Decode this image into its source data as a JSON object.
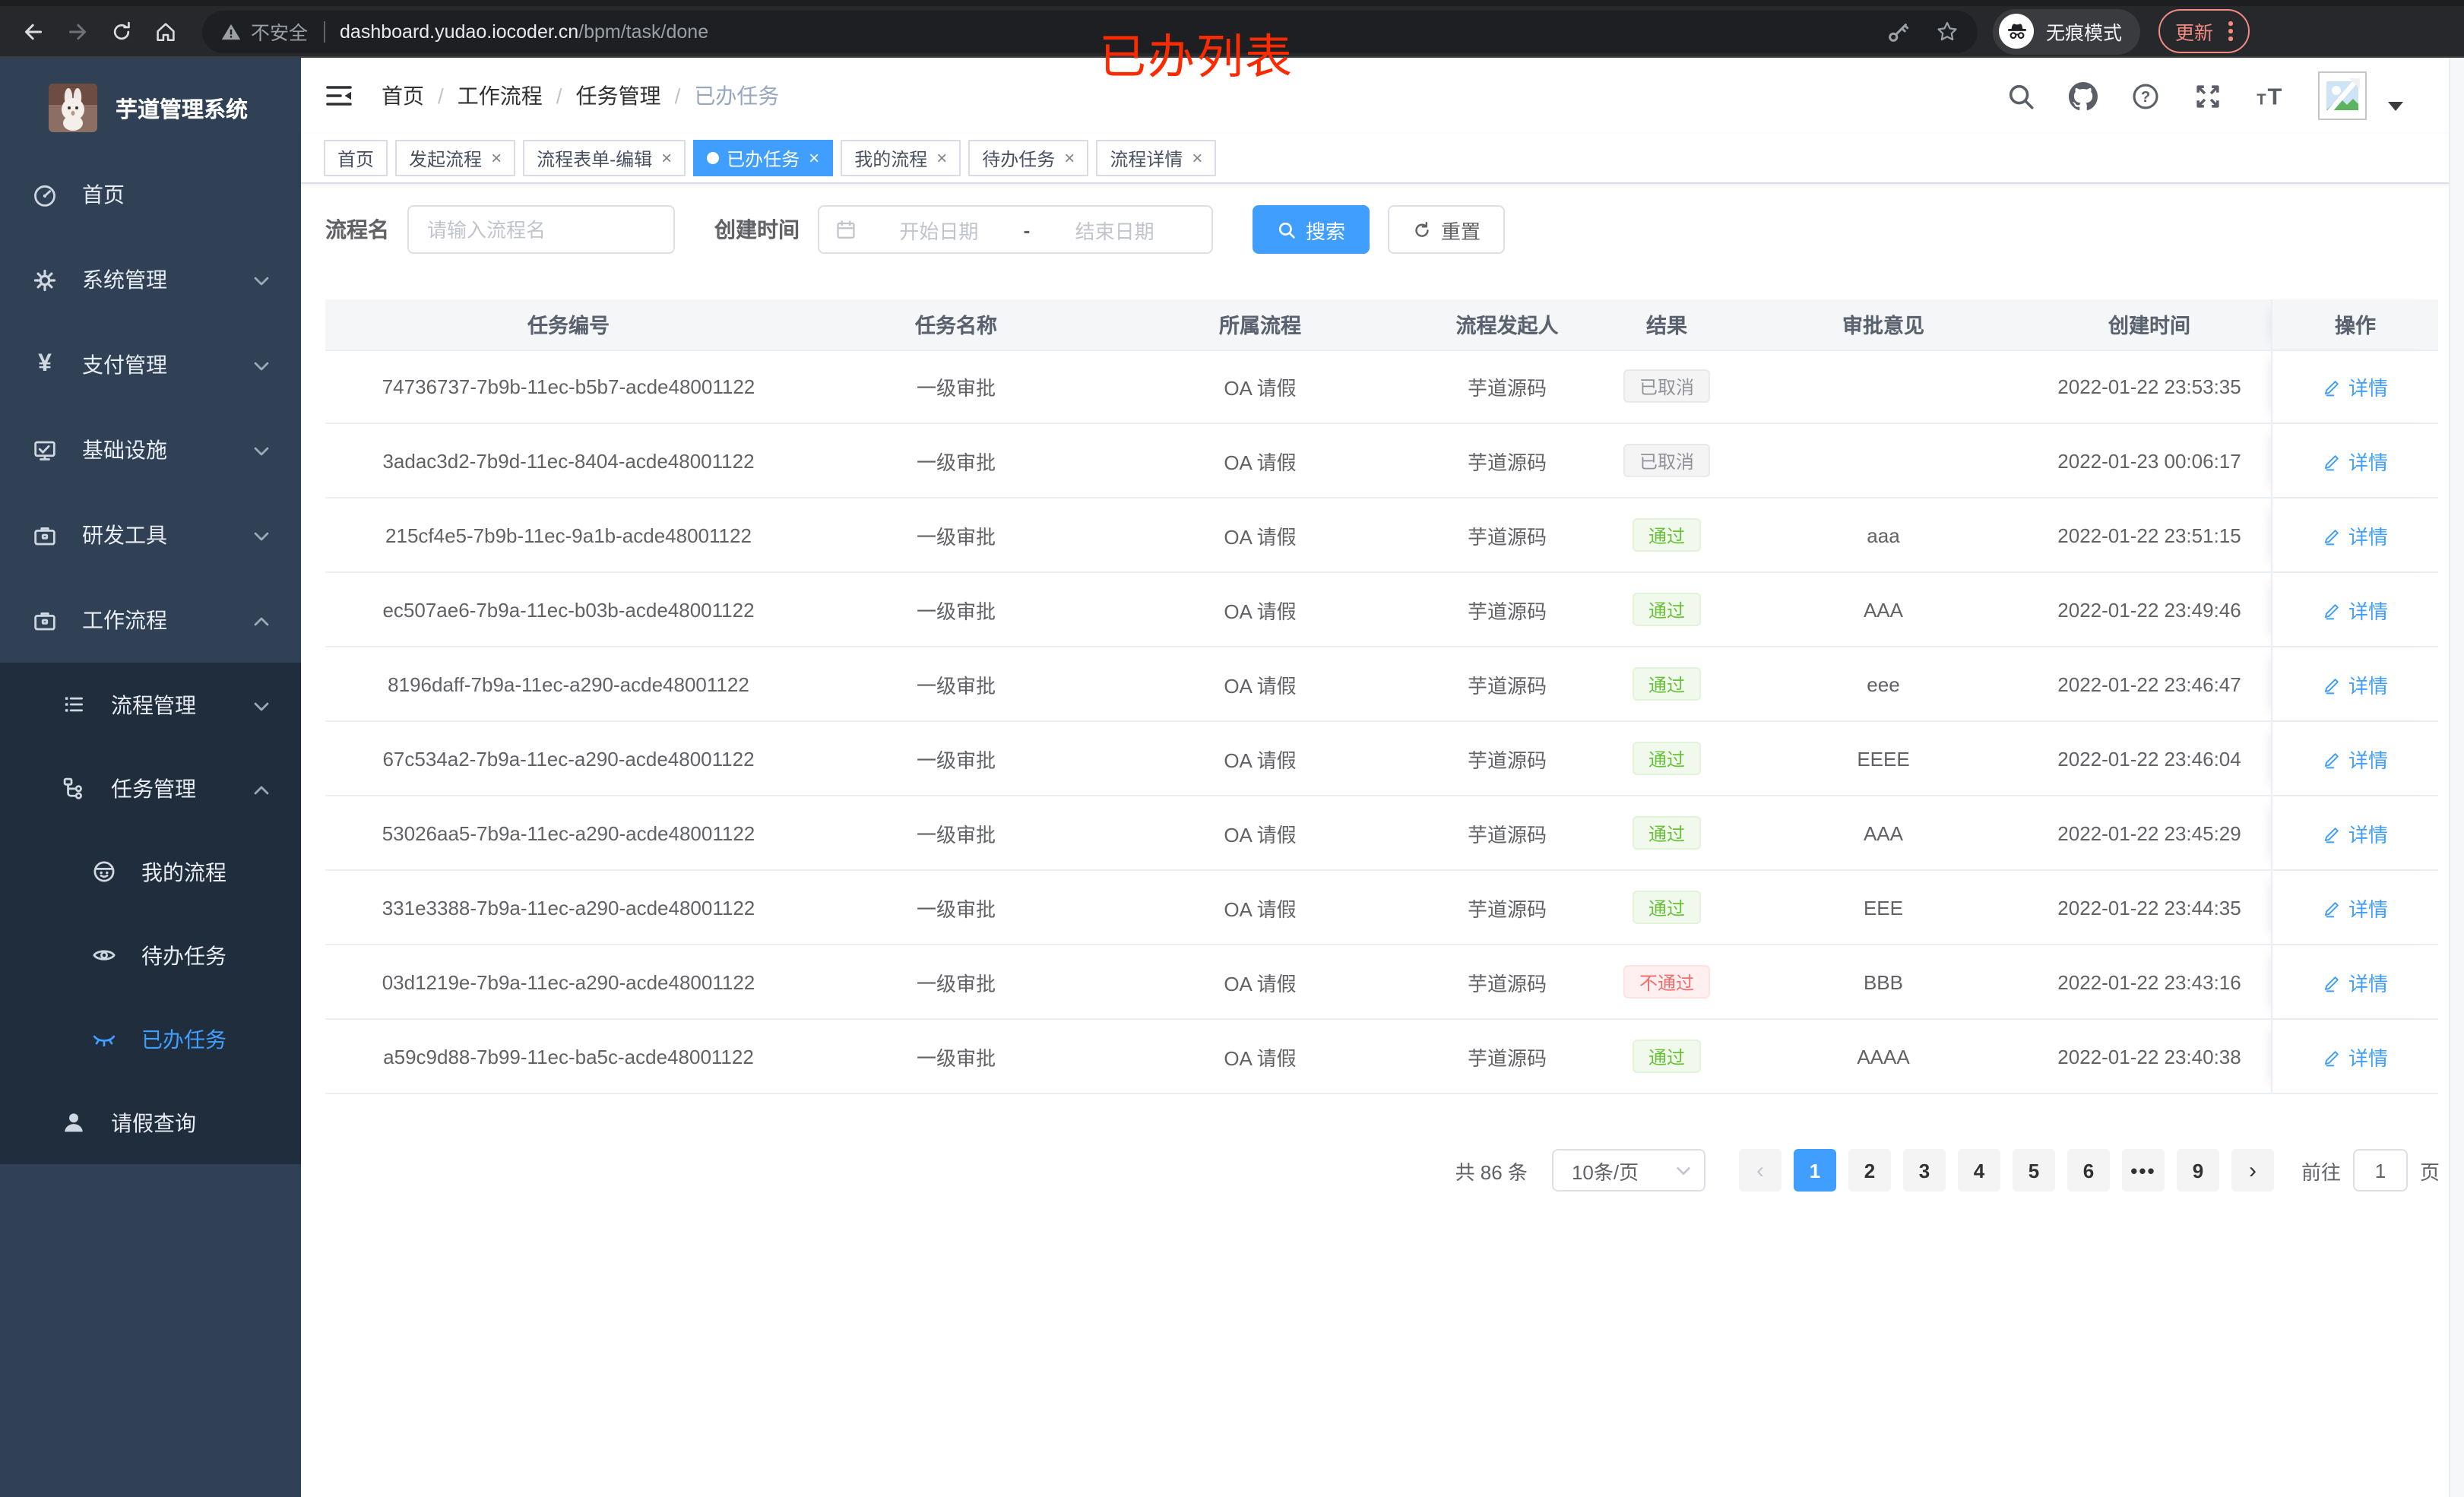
{
  "colors": {
    "primary": "#409eff",
    "success_text": "#67c23a",
    "danger_text": "#f56c6c",
    "info_text": "#909399",
    "overlay_red": "#fa2b00",
    "sidebar_bg": "#304156",
    "submenu_bg": "#1f2d3d"
  },
  "browser": {
    "security_label": "不安全",
    "url_host": "dashboard.yudao.iocoder.cn",
    "url_path": "/bpm/task/done",
    "incognito_label": "无痕模式",
    "update_label": "更新",
    "overlay_title": "已办列表"
  },
  "sidebar": {
    "app_title": "芋道管理系统",
    "items": [
      {
        "label": "首页",
        "icon": "dashboard-icon",
        "level": 1
      },
      {
        "label": "系统管理",
        "icon": "gear-icon",
        "level": 1,
        "chevron": "down"
      },
      {
        "label": "支付管理",
        "icon": "yen-icon",
        "level": 1,
        "chevron": "down"
      },
      {
        "label": "基础设施",
        "icon": "infra-icon",
        "level": 1,
        "chevron": "down"
      },
      {
        "label": "研发工具",
        "icon": "toolbox-icon",
        "level": 1,
        "chevron": "down"
      },
      {
        "label": "工作流程",
        "icon": "workflow-icon",
        "level": 1,
        "chevron": "up"
      },
      {
        "label": "流程管理",
        "icon": "process-list-icon",
        "level": 2,
        "chevron": "down",
        "dark": true
      },
      {
        "label": "任务管理",
        "icon": "task-tree-icon",
        "level": 2,
        "chevron": "up",
        "dark": true
      },
      {
        "label": "我的流程",
        "icon": "robot-icon",
        "level": 3,
        "dark": true
      },
      {
        "label": "待办任务",
        "icon": "eye-open-icon",
        "level": 3,
        "dark": true
      },
      {
        "label": "已办任务",
        "icon": "eye-closed-icon",
        "level": 3,
        "dark": true,
        "active": true
      },
      {
        "label": "请假查询",
        "icon": "user-icon",
        "level": 2,
        "dark": true
      }
    ]
  },
  "header": {
    "breadcrumb": [
      "首页",
      "工作流程",
      "任务管理",
      "已办任务"
    ],
    "separator": "/"
  },
  "tabs": {
    "close_glyph": "×",
    "items": [
      {
        "label": "首页",
        "closable": false
      },
      {
        "label": "发起流程",
        "closable": true
      },
      {
        "label": "流程表单-编辑",
        "closable": true
      },
      {
        "label": "已办任务",
        "closable": true,
        "active": true
      },
      {
        "label": "我的流程",
        "closable": true
      },
      {
        "label": "待办任务",
        "closable": true
      },
      {
        "label": "流程详情",
        "closable": true
      }
    ]
  },
  "filters": {
    "name_label": "流程名",
    "name_placeholder": "请输入流程名",
    "date_label": "创建时间",
    "date_start_placeholder": "开始日期",
    "date_separator": "-",
    "date_end_placeholder": "结束日期",
    "search_label": "搜索",
    "reset_label": "重置"
  },
  "table": {
    "columns": [
      "任务编号",
      "任务名称",
      "所属流程",
      "流程发起人",
      "结果",
      "审批意见",
      "创建时间",
      "操作"
    ],
    "action_label": "详情",
    "rows": [
      {
        "id": "74736737-7b9b-11ec-b5b7-acde48001122",
        "name": "一级审批",
        "process": "OA 请假",
        "starter": "芋道源码",
        "result": "已取消",
        "result_type": "info",
        "comment": "",
        "created": "2022-01-22 23:53:35"
      },
      {
        "id": "3adac3d2-7b9d-11ec-8404-acde48001122",
        "name": "一级审批",
        "process": "OA 请假",
        "starter": "芋道源码",
        "result": "已取消",
        "result_type": "info",
        "comment": "",
        "created": "2022-01-23 00:06:17"
      },
      {
        "id": "215cf4e5-7b9b-11ec-9a1b-acde48001122",
        "name": "一级审批",
        "process": "OA 请假",
        "starter": "芋道源码",
        "result": "通过",
        "result_type": "success",
        "comment": "aaa",
        "created": "2022-01-22 23:51:15"
      },
      {
        "id": "ec507ae6-7b9a-11ec-b03b-acde48001122",
        "name": "一级审批",
        "process": "OA 请假",
        "starter": "芋道源码",
        "result": "通过",
        "result_type": "success",
        "comment": "AAA",
        "created": "2022-01-22 23:49:46"
      },
      {
        "id": "8196daff-7b9a-11ec-a290-acde48001122",
        "name": "一级审批",
        "process": "OA 请假",
        "starter": "芋道源码",
        "result": "通过",
        "result_type": "success",
        "comment": "eee",
        "created": "2022-01-22 23:46:47"
      },
      {
        "id": "67c534a2-7b9a-11ec-a290-acde48001122",
        "name": "一级审批",
        "process": "OA 请假",
        "starter": "芋道源码",
        "result": "通过",
        "result_type": "success",
        "comment": "EEEE",
        "created": "2022-01-22 23:46:04"
      },
      {
        "id": "53026aa5-7b9a-11ec-a290-acde48001122",
        "name": "一级审批",
        "process": "OA 请假",
        "starter": "芋道源码",
        "result": "通过",
        "result_type": "success",
        "comment": "AAA",
        "created": "2022-01-22 23:45:29"
      },
      {
        "id": "331e3388-7b9a-11ec-a290-acde48001122",
        "name": "一级审批",
        "process": "OA 请假",
        "starter": "芋道源码",
        "result": "通过",
        "result_type": "success",
        "comment": "EEE",
        "created": "2022-01-22 23:44:35"
      },
      {
        "id": "03d1219e-7b9a-11ec-a290-acde48001122",
        "name": "一级审批",
        "process": "OA 请假",
        "starter": "芋道源码",
        "result": "不通过",
        "result_type": "danger",
        "comment": "BBB",
        "created": "2022-01-22 23:43:16"
      },
      {
        "id": "a59c9d88-7b99-11ec-ba5c-acde48001122",
        "name": "一级审批",
        "process": "OA 请假",
        "starter": "芋道源码",
        "result": "通过",
        "result_type": "success",
        "comment": "AAAA",
        "created": "2022-01-22 23:40:38"
      }
    ]
  },
  "pagination": {
    "total_label": "共 86 条",
    "page_size": "10条/页",
    "prev_enabled": false,
    "pages": [
      "1",
      "2",
      "3",
      "4",
      "5",
      "6",
      "•••",
      "9"
    ],
    "active_page": "1",
    "goto_label": "前往",
    "goto_value": "1",
    "goto_unit": "页"
  }
}
